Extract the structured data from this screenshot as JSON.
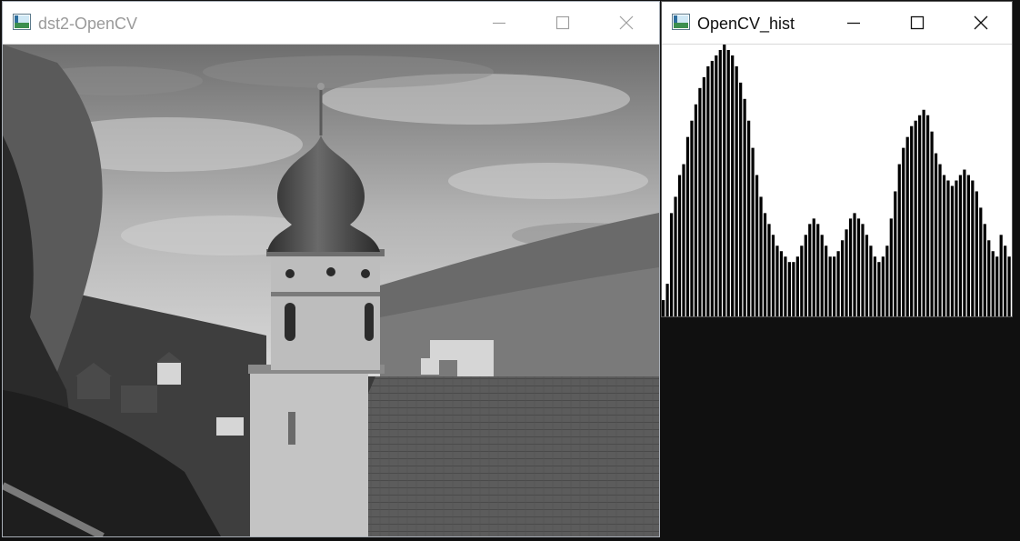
{
  "windows": {
    "image": {
      "title": "dst2-OpenCV",
      "state": "inactive",
      "content": "grayscale photo: onion-dome church tower with tiled roof, forested hills, village and cloudy sky"
    },
    "hist": {
      "title": "OpenCV_hist",
      "state": "active"
    }
  },
  "icons": {
    "app": "opencv-window-icon",
    "minimize": "minimize-icon",
    "maximize": "maximize-icon",
    "close": "close-icon"
  },
  "colors": {
    "desktop": "#101010",
    "histogram_fill": "#000000",
    "histogram_background": "#ffffff"
  },
  "chart_data": {
    "type": "bar",
    "description": "intensity histogram (256 bins, normalized, drawn as black columns)",
    "x_range": [
      0,
      255
    ],
    "y_range": [
      0,
      1
    ],
    "values": [
      0.06,
      0.12,
      0.38,
      0.44,
      0.52,
      0.56,
      0.66,
      0.72,
      0.78,
      0.84,
      0.88,
      0.92,
      0.94,
      0.96,
      0.98,
      1.0,
      0.98,
      0.96,
      0.92,
      0.86,
      0.8,
      0.72,
      0.62,
      0.52,
      0.44,
      0.38,
      0.34,
      0.3,
      0.26,
      0.24,
      0.22,
      0.2,
      0.2,
      0.22,
      0.26,
      0.3,
      0.34,
      0.36,
      0.34,
      0.3,
      0.26,
      0.22,
      0.22,
      0.24,
      0.28,
      0.32,
      0.36,
      0.38,
      0.36,
      0.34,
      0.3,
      0.26,
      0.22,
      0.2,
      0.22,
      0.26,
      0.36,
      0.46,
      0.56,
      0.62,
      0.66,
      0.7,
      0.72,
      0.74,
      0.76,
      0.74,
      0.68,
      0.6,
      0.56,
      0.52,
      0.5,
      0.48,
      0.5,
      0.52,
      0.54,
      0.52,
      0.5,
      0.46,
      0.4,
      0.34,
      0.28,
      0.24,
      0.22,
      0.3,
      0.26,
      0.22
    ]
  }
}
